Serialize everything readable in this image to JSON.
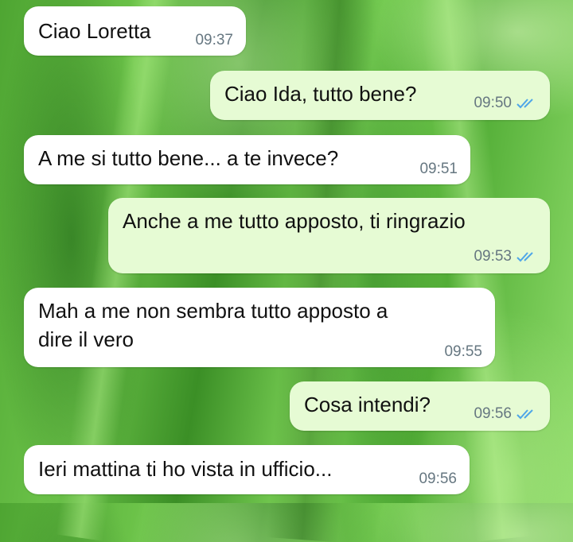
{
  "colors": {
    "incoming_bubble": "#ffffff",
    "outgoing_bubble": "#e6fbd4",
    "read_tick": "#4fa6e8",
    "timestamp": "#667781"
  },
  "messages": [
    {
      "direction": "incoming",
      "text": "Ciao Loretta",
      "time": "09:37"
    },
    {
      "direction": "outgoing",
      "text": "Ciao Ida, tutto bene?",
      "time": "09:50",
      "status_icon": "double-check-read-icon"
    },
    {
      "direction": "incoming",
      "text": "A me si tutto bene... a te invece?",
      "time": "09:51"
    },
    {
      "direction": "outgoing",
      "text": "Anche a me tutto apposto, ti ringrazio",
      "time": "09:53",
      "status_icon": "double-check-read-icon"
    },
    {
      "direction": "incoming",
      "text_line1": "Mah a me non sembra tutto apposto a",
      "text_line2": "dire il vero",
      "time": "09:55"
    },
    {
      "direction": "outgoing",
      "text": "Cosa intendi?",
      "time": "09:56",
      "status_icon": "double-check-read-icon"
    },
    {
      "direction": "incoming",
      "text": "Ieri mattina ti ho vista in ufficio...",
      "time": "09:56"
    }
  ]
}
